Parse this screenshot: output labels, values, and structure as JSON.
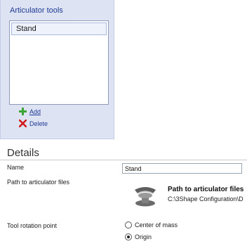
{
  "articulator_tools": {
    "title": "Articulator tools",
    "items": [
      {
        "label": "Stand"
      }
    ],
    "add_label": "Add",
    "delete_label": "Delete"
  },
  "details": {
    "title": "Details",
    "name_label": "Name",
    "name_value": "Stand",
    "path_label": "Path to articulator files",
    "path_button": {
      "title": "Path to articulator files",
      "value": "C:\\3Shape Configuration\\D"
    },
    "rotation_label": "Tool rotation point",
    "rotation_options": [
      {
        "label": "Center of mass",
        "selected": false
      },
      {
        "label": "Origin",
        "selected": true
      }
    ]
  },
  "icons": {
    "add": "plus-icon",
    "delete": "x-icon",
    "path": "articulator-folder-icon"
  },
  "colors": {
    "link": "#1f3a93",
    "add_icon": "#3aa534",
    "delete_icon": "#d11a1a"
  }
}
